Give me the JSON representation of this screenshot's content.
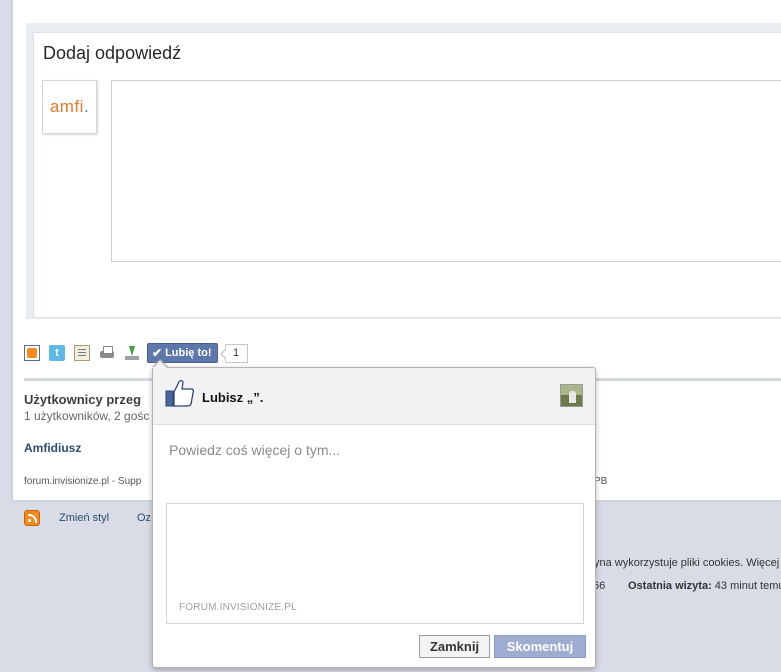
{
  "reply": {
    "title": "Dodaj odpowiedź",
    "avatar_logo": {
      "text": "amfi",
      "dot": "."
    }
  },
  "toolbar": {
    "icons": [
      "rss-icon",
      "twitter-icon",
      "document-icon",
      "print-icon",
      "download-icon"
    ],
    "like_label": "Lubię to!",
    "like_count": "1"
  },
  "users": {
    "title": "Użytkownicy przeg",
    "subtitle": "1 użytkowników, 2 gośc",
    "user_link": "Amfidiusz"
  },
  "footer": {
    "left": "forum.invisionize.pl - Supp",
    "right": "PB"
  },
  "bottom": {
    "change_style": "Zmień styl",
    "oz": "Oz",
    "cookies": "yna wykorzystuje pliki cookies. Więcej",
    "stat_num": "66",
    "last_visit_label": "Ostatnia wizyta:",
    "last_visit_value": " 43 minut temu"
  },
  "popup": {
    "title": "Lubisz „”.",
    "placeholder": "Powiedz coś więcej o tym...",
    "preview_caption": "FORUM.INVISIONIZE.PL",
    "close_label": "Zamknij",
    "comment_label": "Skomentuj"
  },
  "colors": {
    "like_button": "#5f78ab",
    "comment_button": "#9dacd0",
    "link": "#2e4c6e",
    "page_bg": "#d8dce6"
  }
}
